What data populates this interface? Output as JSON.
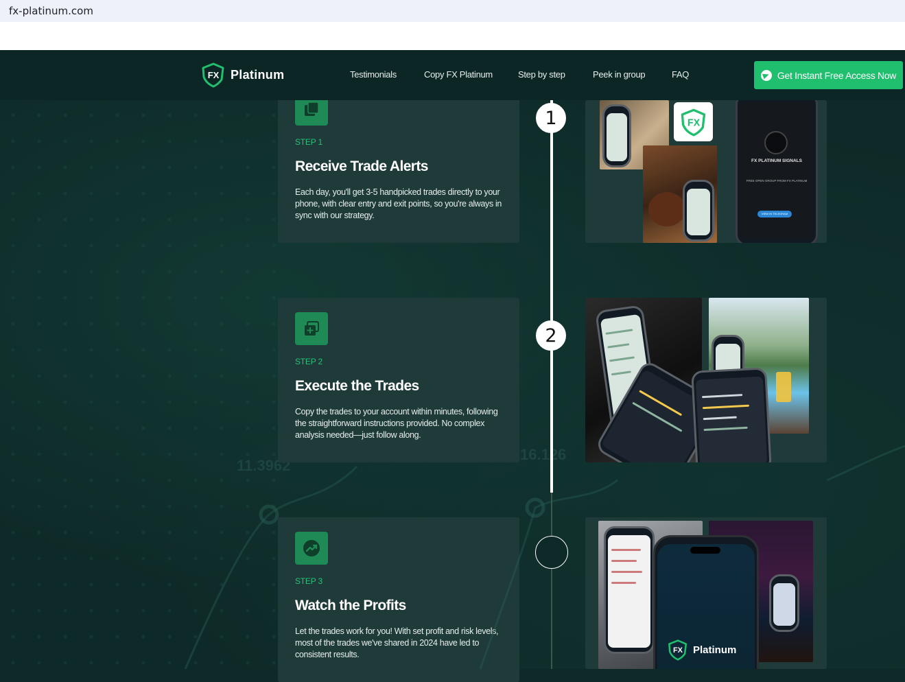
{
  "browser": {
    "url": "fx-platinum.com"
  },
  "nav": {
    "logo_text": "Platinum",
    "logo_mark": "FX",
    "links": [
      "Testimonials",
      "Copy FX Platinum",
      "Step by step",
      "Peek in group",
      "FAQ"
    ],
    "cta_label": "Get Instant Free Access Now"
  },
  "steps": [
    {
      "marker": "1",
      "label": "STEP 1",
      "title": "Receive Trade Alerts",
      "description": "Each day, you'll get 3-5 handpicked trades directly to your phone, with clear entry and exit points, so you're always in sync with our strategy."
    },
    {
      "marker": "2",
      "label": "STEP 2",
      "title": "Execute the Trades",
      "description": "Copy the trades to your account within minutes, following the straightforward instructions provided. No complex analysis needed—just follow along."
    },
    {
      "marker": "",
      "label": "STEP 3",
      "title": "Watch the Profits",
      "description": "Let the trades work for you! With set profit and risk levels, most of the trades we've shared in 2024 have led to consistent results."
    }
  ],
  "panels": {
    "step1_phone_title": "FX PLATINUM SIGNALS",
    "step1_phone_sub": "FREE OPEN GROUP FROM FX PLATINUM",
    "step1_phone_button": "VIEW IN TELEGRAM",
    "step3_phone_logo": "Platinum",
    "step3_phone_mark": "FX"
  },
  "background": {
    "numbers": [
      "11.3962",
      "16.126"
    ]
  }
}
